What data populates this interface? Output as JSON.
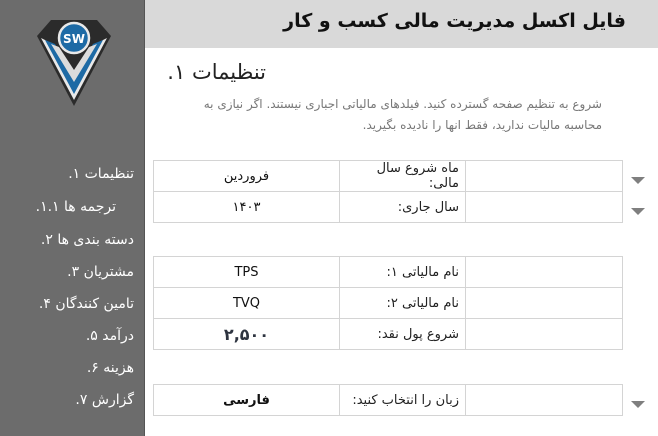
{
  "header": {
    "title": "فایل اکسل مدیریت مالی کسب و کار"
  },
  "logo": {
    "text": "SW"
  },
  "sidebar": {
    "items": [
      {
        "label": "تنظیمات ۱."
      },
      {
        "label": "ترجمه ها ۱.۱."
      },
      {
        "label": "دسته بندی ها ۲."
      },
      {
        "label": "مشتریان ۳."
      },
      {
        "label": "تامین کنندگان ۴."
      },
      {
        "label": "درآمد ۵."
      },
      {
        "label": "هزینه ۶."
      },
      {
        "label": "گزارش ۷."
      }
    ]
  },
  "main": {
    "page_title": "تنظیمات ۱.",
    "intro": "شروع به تنظیم صفحه گسترده کنید. فیلدهای مالیاتی اجباری نیستند. اگر نیازی به محاسبه مالیات ندارید، فقط انها را نادیده بگیرید.",
    "fiscal": [
      {
        "label": "ماه شروع سال مالی:",
        "value": "فروردین"
      },
      {
        "label": "سال جاری:",
        "value": "۱۴۰۳"
      }
    ],
    "taxes": [
      {
        "label": "نام مالیاتی ۱:",
        "value": "TPS"
      },
      {
        "label": "نام مالیاتی ۲:",
        "value": "TVQ"
      },
      {
        "label": "شروع پول نقد:",
        "value": "۲,۵۰۰"
      }
    ],
    "language": {
      "label": "زبان را انتخاب کنید:",
      "value": "فارسی"
    }
  },
  "colors": {
    "sidebar_bg": "#6c6c6c",
    "header_bg": "#d9d9d9",
    "logo_blue": "#1d6aa5",
    "border": "#d4d4d4"
  },
  "icons": {
    "dropdown": "chevron-down-icon",
    "logo": "diamond-icon"
  }
}
